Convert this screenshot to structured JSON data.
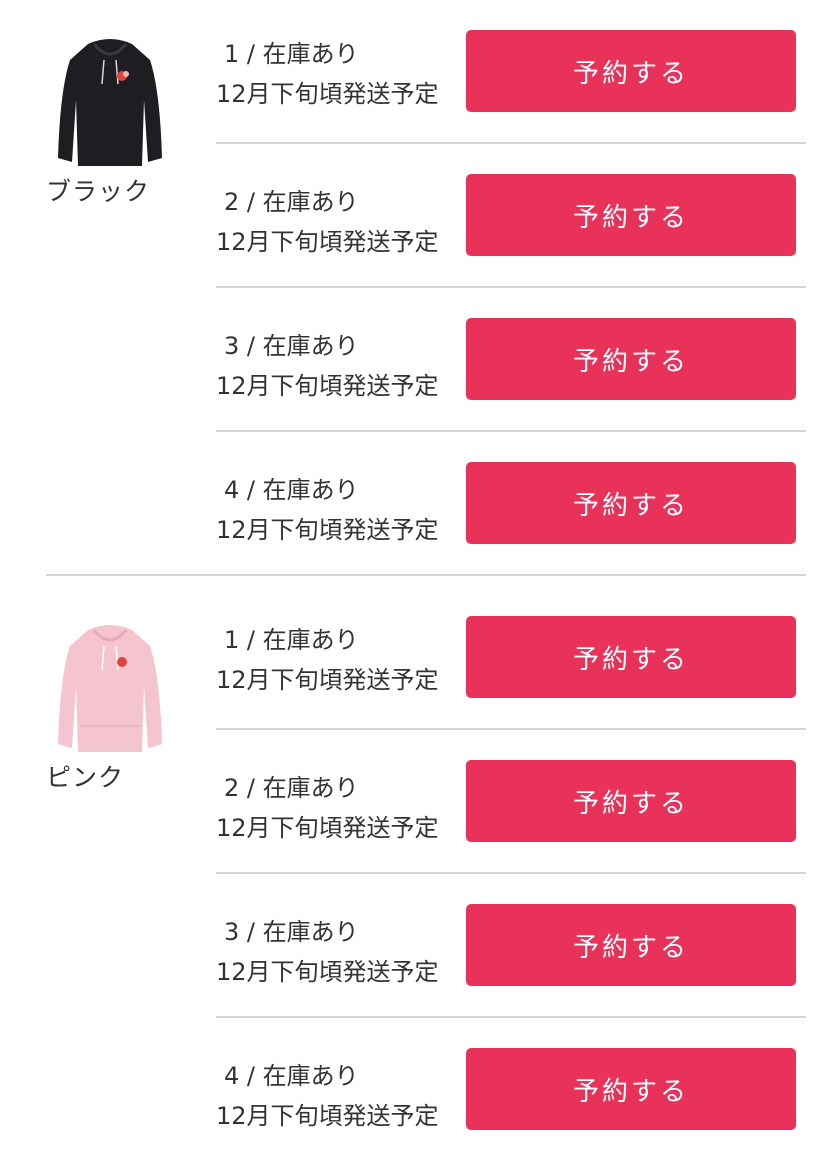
{
  "accent_color": "#e8325a",
  "products": [
    {
      "name": "ブラック",
      "image_icon": "black-hoodie-image",
      "sizes": [
        {
          "size": "1",
          "stock": "在庫あり",
          "shipping": "12月下旬頃発送予定",
          "button": "予約する"
        },
        {
          "size": "2",
          "stock": "在庫あり",
          "shipping": "12月下旬頃発送予定",
          "button": "予約する"
        },
        {
          "size": "3",
          "stock": "在庫あり",
          "shipping": "12月下旬頃発送予定",
          "button": "予約する"
        },
        {
          "size": "4",
          "stock": "在庫あり",
          "shipping": "12月下旬頃発送予定",
          "button": "予約する"
        }
      ]
    },
    {
      "name": "ピンク",
      "image_icon": "pink-hoodie-image",
      "sizes": [
        {
          "size": "1",
          "stock": "在庫あり",
          "shipping": "12月下旬頃発送予定",
          "button": "予約する"
        },
        {
          "size": "2",
          "stock": "在庫あり",
          "shipping": "12月下旬頃発送予定",
          "button": "予約する"
        },
        {
          "size": "3",
          "stock": "在庫あり",
          "shipping": "12月下旬頃発送予定",
          "button": "予約する"
        },
        {
          "size": "4",
          "stock": "在庫あり",
          "shipping": "12月下旬頃発送予定",
          "button": "予約する"
        }
      ]
    }
  ]
}
